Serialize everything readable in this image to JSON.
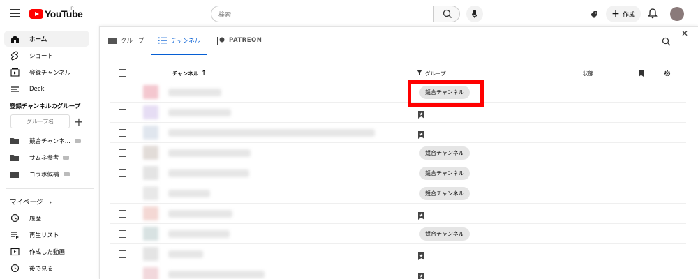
{
  "topbar": {
    "logo_text": "YouTube",
    "logo_sup": "JP",
    "search_placeholder": "検索",
    "create_label": "作成"
  },
  "sidebar": {
    "items": [
      {
        "label": "ホーム",
        "icon": "home-icon",
        "active": true
      },
      {
        "label": "ショート",
        "icon": "shorts-icon"
      },
      {
        "label": "登録チャンネル",
        "icon": "subscriptions-icon"
      },
      {
        "label": "Deck",
        "icon": "deck-icon"
      }
    ],
    "groups_heading": "登録チャンネルのグループ",
    "group_input_placeholder": "グループ名",
    "groups": [
      {
        "label": "競合チャンネ..."
      },
      {
        "label": "サムネ参考"
      },
      {
        "label": "コラボ候補"
      }
    ],
    "mypage_heading": "マイページ",
    "mypage_items": [
      {
        "label": "履歴",
        "icon": "history-icon"
      },
      {
        "label": "再生リスト",
        "icon": "playlist-icon"
      },
      {
        "label": "作成した動画",
        "icon": "your-videos-icon"
      },
      {
        "label": "後で見る",
        "icon": "watch-later-icon"
      }
    ]
  },
  "panel": {
    "tabs": [
      {
        "label": "グループ",
        "icon": "folder-icon"
      },
      {
        "label": "チャンネル",
        "icon": "list-icon",
        "active": true
      },
      {
        "label": "PATREON",
        "icon": "patreon-icon"
      }
    ],
    "columns": {
      "channel": "チャンネル",
      "group": "グループ",
      "status": "状態"
    },
    "rows": [
      {
        "group": "競合チャンネル",
        "thumb": "#f4c7cf",
        "w": 76
      },
      {
        "group": "",
        "thumb": "#e6ddf4",
        "w": 90
      },
      {
        "group": "",
        "thumb": "#e0e6ee",
        "w": 296
      },
      {
        "group": "競合チャンネル",
        "thumb": "#e2dcd8",
        "w": 118
      },
      {
        "group": "競合チャンネル",
        "thumb": "#e4e4e4",
        "w": 116
      },
      {
        "group": "競合チャンネル",
        "thumb": "#e8e8e8",
        "w": 60
      },
      {
        "group": "",
        "thumb": "#f4d8d4",
        "w": 92
      },
      {
        "group": "競合チャンネル",
        "thumb": "#d8e2e2",
        "w": 88
      },
      {
        "group": "",
        "thumb": "#e4e4e4",
        "w": 50
      },
      {
        "group": "",
        "thumb": "#f2d8dc",
        "w": 138
      }
    ]
  },
  "colors": {
    "accent": "#065fd4",
    "brand": "#ff0000",
    "highlight": "#ff0000"
  }
}
